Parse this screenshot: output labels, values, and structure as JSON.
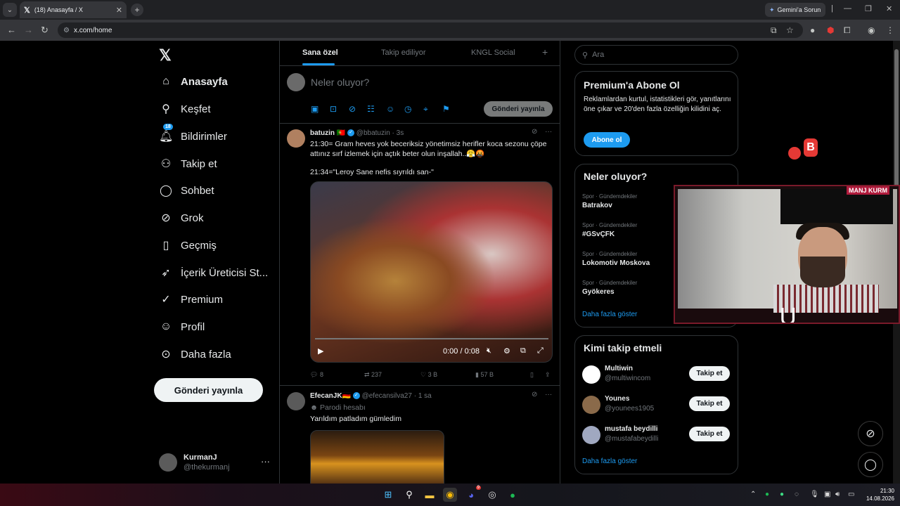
{
  "browser": {
    "tab_title": "(18) Anasayfa / X",
    "url": "x.com/home",
    "gemini_label": "Gemini'a Sorun"
  },
  "nav": {
    "items": [
      {
        "label": "Anasayfa",
        "icon": "home-icon"
      },
      {
        "label": "Keşfet",
        "icon": "search-icon"
      },
      {
        "label": "Bildirimler",
        "icon": "bell-icon",
        "badge": "18"
      },
      {
        "label": "Takip et",
        "icon": "person-add-icon"
      },
      {
        "label": "Sohbet",
        "icon": "chat-icon"
      },
      {
        "label": "Grok",
        "icon": "grok-icon"
      },
      {
        "label": "Geçmiş",
        "icon": "bookmark-icon"
      },
      {
        "label": "İçerik Üreticisi St...",
        "icon": "rocket-icon"
      },
      {
        "label": "Premium",
        "icon": "premium-icon"
      },
      {
        "label": "Profil",
        "icon": "profile-icon"
      },
      {
        "label": "Daha fazla",
        "icon": "more-icon"
      }
    ],
    "post_button": "Gönderi yayınla",
    "account": {
      "name": "KurmanJ",
      "handle": "@thekurmanj"
    }
  },
  "feed": {
    "tabs": [
      "Sana özel",
      "Takip ediliyor",
      "KNGL Social"
    ],
    "compose_placeholder": "Neler oluyor?",
    "compose_button": "Gönderi yayınla",
    "tweets": [
      {
        "name": "batuzin",
        "handle": "@bbatuzin",
        "time": "3s",
        "text": "21:30= Gram heves yok beceriksiz yönetimsiz herifler koca sezonu çöpe attınız sırf izlemek için açtık beter olun inşallah..😤🤬",
        "text2": "21:34=\"Leroy Sane nefis sıyrıldı san-\"",
        "video_time": "0:00 / 0:08",
        "replies": "8",
        "reposts": "237",
        "likes": "3 B",
        "views": "57 B"
      },
      {
        "name": "EfecanJK🇩🇪",
        "handle": "@efecansilva27",
        "time": "1 sa",
        "parody": "Parodi hesabı",
        "text": "Yarıldım patladım gümledim"
      }
    ]
  },
  "sidebar": {
    "search_placeholder": "Ara",
    "premium": {
      "title": "Premium'a Abone Ol",
      "desc": "Reklamlardan kurtul, istatistikleri gör, yanıtlarını öne çıkar ve 20'den fazla özelliğin kilidini aç.",
      "button": "Abone ol"
    },
    "trends": {
      "title": "Neler oluyor?",
      "items": [
        {
          "category": "Spor · Gündemdekiler",
          "name": "Batrakov"
        },
        {
          "category": "Spor · Gündemdekiler",
          "name": "#GSvÇFK"
        },
        {
          "category": "Spor · Gündemdekiler",
          "name": "Lokomotiv Moskova"
        },
        {
          "category": "Spor · Gündemdekiler",
          "name": "Gyökeres"
        }
      ],
      "show_more": "Daha fazla göster"
    },
    "who_to_follow": {
      "title": "Kimi takip etmeli",
      "items": [
        {
          "name": "Multiwin",
          "handle": "@multiwincom",
          "button": "Takip et"
        },
        {
          "name": "Younes",
          "handle": "@younees1905",
          "button": "Takip et"
        },
        {
          "name": "mustafa beydilli",
          "handle": "@mustafabeydilli",
          "button": "Takip et"
        }
      ],
      "show_more": "Daha fazla göster"
    }
  },
  "overlay": {
    "cam_tag": "MANJ  KURM",
    "badge_letter": "B"
  },
  "taskbar": {
    "time": "21:30",
    "date": "14.08.2026",
    "discord_badge": "9"
  },
  "colors": {
    "accent": "#1d9bf0",
    "background": "#000000",
    "border": "#2f3336"
  }
}
